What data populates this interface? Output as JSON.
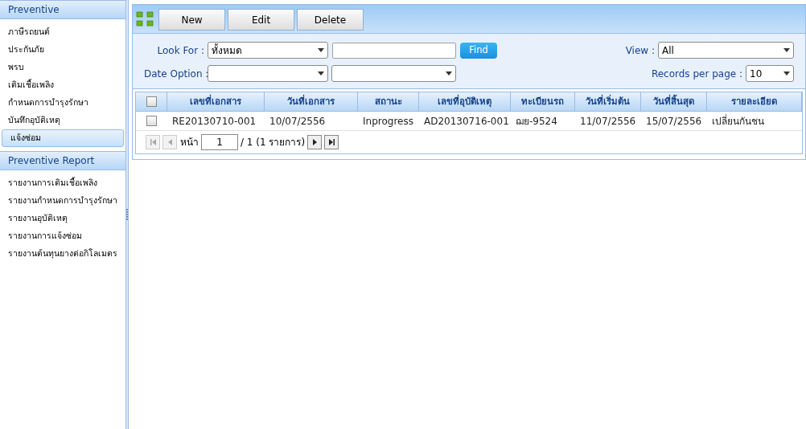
{
  "sidebar": {
    "sections": [
      {
        "title": "Preventive",
        "items": [
          {
            "label": "ภาษีรถยนต์",
            "selected": false
          },
          {
            "label": "ประกันภัย",
            "selected": false
          },
          {
            "label": "พรบ",
            "selected": false
          },
          {
            "label": "เติมเชื้อเพลิง",
            "selected": false
          },
          {
            "label": "กำหนดการบำรุงรักษา",
            "selected": false
          },
          {
            "label": "บันทึกอุบัติเหตุ",
            "selected": false
          },
          {
            "label": "แจ้งซ่อม",
            "selected": true
          }
        ]
      },
      {
        "title": "Preventive Report",
        "items": [
          {
            "label": "รายงานการเติมเชื้อเพลิง",
            "selected": false
          },
          {
            "label": "รายงานกำหนดการบำรุงรักษา",
            "selected": false
          },
          {
            "label": "รายงานอุบัติเหตุ",
            "selected": false
          },
          {
            "label": "รายงานการแจ้งซ่อม",
            "selected": false
          },
          {
            "label": "รายงานต้นทุนยางต่อกิโลเมตร",
            "selected": false
          }
        ]
      }
    ]
  },
  "toolbar": {
    "buttons": [
      "New",
      "Edit",
      "Delete"
    ]
  },
  "filters": {
    "look_for": {
      "label": "Look For :",
      "value": "ทั้งหมด"
    },
    "find_button": "Find",
    "date_option": {
      "label": "Date Option :"
    },
    "view": {
      "label": "View :",
      "value": "All"
    },
    "records_per_page": {
      "label": "Records per page :",
      "value": "10"
    }
  },
  "table": {
    "columns": [
      "เลขที่เอกสาร",
      "วันที่เอกสาร",
      "สถานะ",
      "เลขที่อุบัติเหตุ",
      "ทะเบียนรถ",
      "วันที่เริ่มต้น",
      "วันที่สิ้นสุด",
      "รายละเอียด"
    ],
    "select_all_checked": false,
    "rows": [
      {
        "checked": false,
        "cells": [
          "RE20130710-001",
          "10/07/2556",
          "Inprogress",
          "AD20130716-001",
          "ฌย-9524",
          "11/07/2556",
          "15/07/2556",
          "เปลี่ยนกันชน"
        ]
      }
    ]
  },
  "pager": {
    "label": "หน้า",
    "page": "1",
    "total": "/ 1 (1 รายการ)"
  }
}
